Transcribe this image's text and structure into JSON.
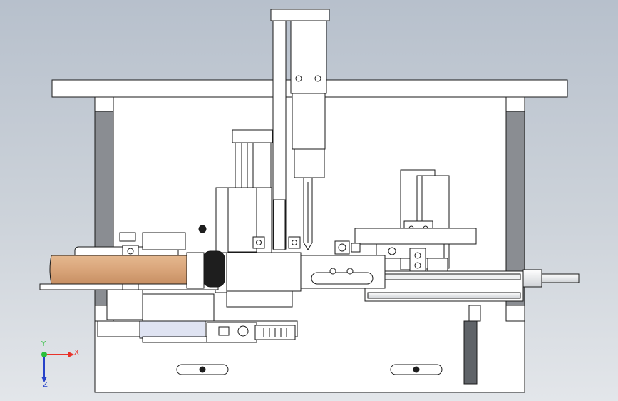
{
  "view": {
    "background_top": "#b7c0cc",
    "background_bottom": "#e3e6ea",
    "part_fill": "#ffffff",
    "part_stroke": "#1a1a1a",
    "shade_grey": "#8a8d92",
    "dark_grey": "#5f6368",
    "tape_reel_color": "#d9a57a",
    "tape_reel_edge": "#b9855c"
  },
  "triad": {
    "x_label": "X",
    "y_label": "Y",
    "z_label": "Z",
    "x_color": "#e8332a",
    "y_color": "#2bbf3a",
    "z_color": "#2742c9"
  }
}
